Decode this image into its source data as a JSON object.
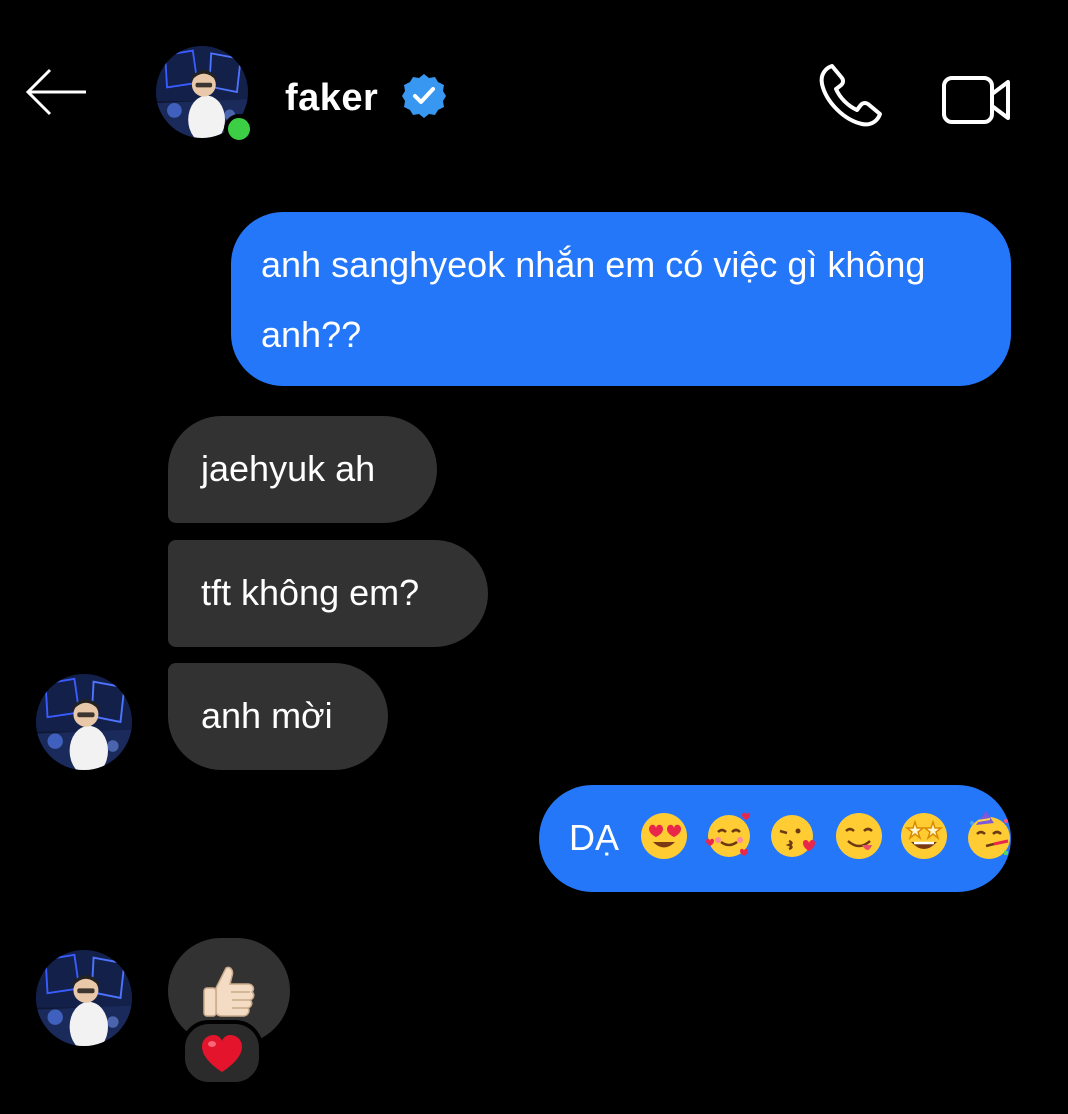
{
  "header": {
    "title": "faker",
    "verified": true,
    "online": true,
    "icons": [
      "back-arrow-icon",
      "phone-icon",
      "video-camera-icon",
      "verified-badge-icon"
    ]
  },
  "messages": [
    {
      "from": "me",
      "text": "anh sanghyeok nhắn em có việc gì không anh??"
    },
    {
      "from": "faker",
      "text": "jaehyuk ah"
    },
    {
      "from": "faker",
      "text": "tft không em?"
    },
    {
      "from": "faker",
      "text": "anh mời"
    },
    {
      "from": "me",
      "text": "DẠ",
      "emojis": [
        "heart-eyes-emoji",
        "smiling-hearts-emoji",
        "kissing-heart-emoji",
        "yum-emoji",
        "star-struck-emoji",
        "partying-face-emoji"
      ]
    },
    {
      "from": "faker",
      "sticker": "thumbs-up-emoji",
      "reaction": "red-heart-emoji"
    }
  ],
  "colors": {
    "background": "#000000",
    "outgoing_bubble": "#2477f9",
    "incoming_bubble": "#323232",
    "online": "#3ccf45",
    "verified": "#3897f0"
  }
}
